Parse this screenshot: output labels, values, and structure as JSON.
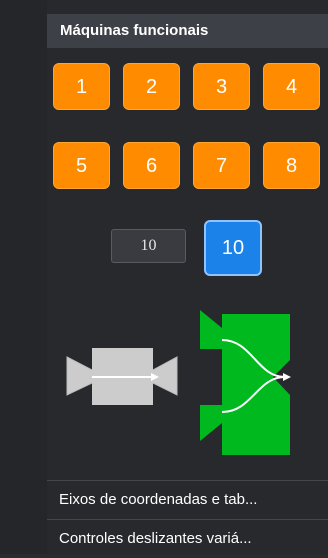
{
  "section": {
    "title": "Máquinas funcionais"
  },
  "number_buttons": [
    "1",
    "2",
    "3",
    "4",
    "5",
    "6",
    "7",
    "8"
  ],
  "input_value": "10",
  "output_value": "10",
  "machines": [
    {
      "name": "line-machine",
      "color": "#cccccc"
    },
    {
      "name": "merge-machine",
      "color": "#00b91f"
    }
  ],
  "list_items": [
    "Eixos de coordenadas e tab...",
    "Controles deslizantes variá..."
  ],
  "colors": {
    "button_orange": "#ff8c00",
    "output_blue": "#1a82e8",
    "machine_gray": "#cccccc",
    "machine_green": "#00b91f"
  }
}
